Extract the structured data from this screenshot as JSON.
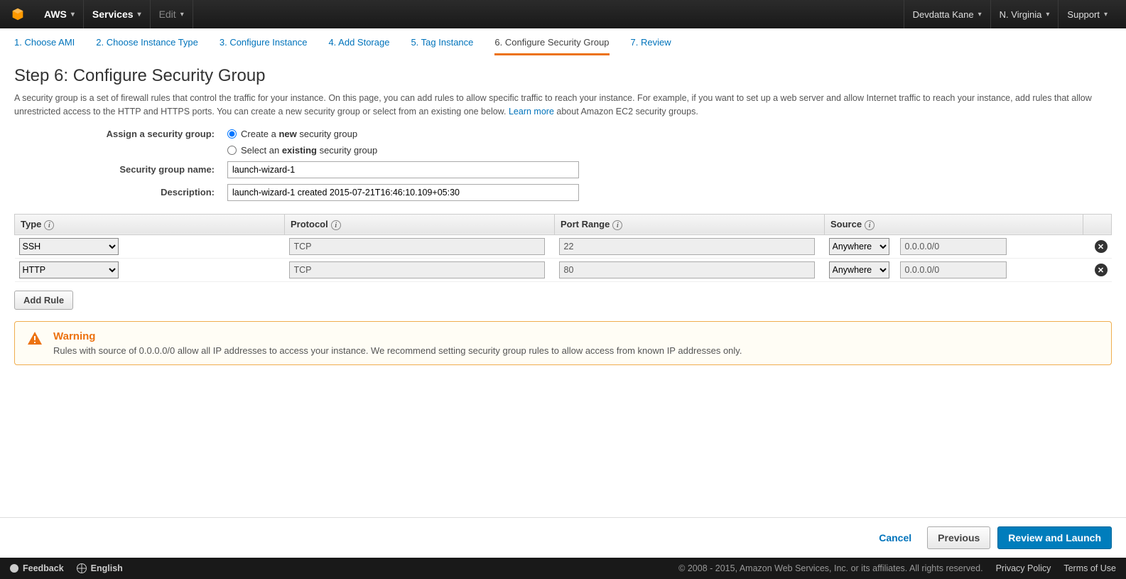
{
  "topnav": {
    "aws": "AWS",
    "services": "Services",
    "edit": "Edit",
    "user": "Devdatta Kane",
    "region": "N. Virginia",
    "support": "Support"
  },
  "wizard": {
    "t1": "1. Choose AMI",
    "t2": "2. Choose Instance Type",
    "t3": "3. Configure Instance",
    "t4": "4. Add Storage",
    "t5": "5. Tag Instance",
    "t6": "6. Configure Security Group",
    "t7": "7. Review"
  },
  "page": {
    "title": "Step 6: Configure Security Group",
    "desc1": "A security group is a set of firewall rules that control the traffic for your instance. On this page, you can add rules to allow specific traffic to reach your instance. For example, if you want to set up a web server and allow Internet traffic to reach your instance, add rules that allow unrestricted access to the HTTP and HTTPS ports. You can create a new security group or select from an existing one below. ",
    "learn": "Learn more",
    "desc2": " about Amazon EC2 security groups."
  },
  "form": {
    "assign_label": "Assign a security group:",
    "radio_new_pre": "Create a ",
    "radio_new_bold": "new",
    "radio_new_post": " security group",
    "radio_existing_pre": "Select an ",
    "radio_existing_bold": "existing",
    "radio_existing_post": " security group",
    "name_label": "Security group name:",
    "name_value": "launch-wizard-1",
    "desc_label": "Description:",
    "desc_value": "launch-wizard-1 created 2015-07-21T16:46:10.109+05:30"
  },
  "table": {
    "h_type": "Type",
    "h_protocol": "Protocol",
    "h_port": "Port Range",
    "h_source": "Source",
    "rows": [
      {
        "type": "SSH",
        "protocol": "TCP",
        "port": "22",
        "source": "Anywhere",
        "cidr": "0.0.0.0/0"
      },
      {
        "type": "HTTP",
        "protocol": "TCP",
        "port": "80",
        "source": "Anywhere",
        "cidr": "0.0.0.0/0"
      }
    ]
  },
  "add_rule": "Add Rule",
  "warning": {
    "title": "Warning",
    "msg": "Rules with source of 0.0.0.0/0 allow all IP addresses to access your instance. We recommend setting security group rules to allow access from known IP addresses only."
  },
  "footer": {
    "cancel": "Cancel",
    "previous": "Previous",
    "review": "Review and Launch"
  },
  "bottom": {
    "feedback": "Feedback",
    "english": "English",
    "copyright": "© 2008 - 2015, Amazon Web Services, Inc. or its affiliates. All rights reserved.",
    "privacy": "Privacy Policy",
    "terms": "Terms of Use"
  }
}
